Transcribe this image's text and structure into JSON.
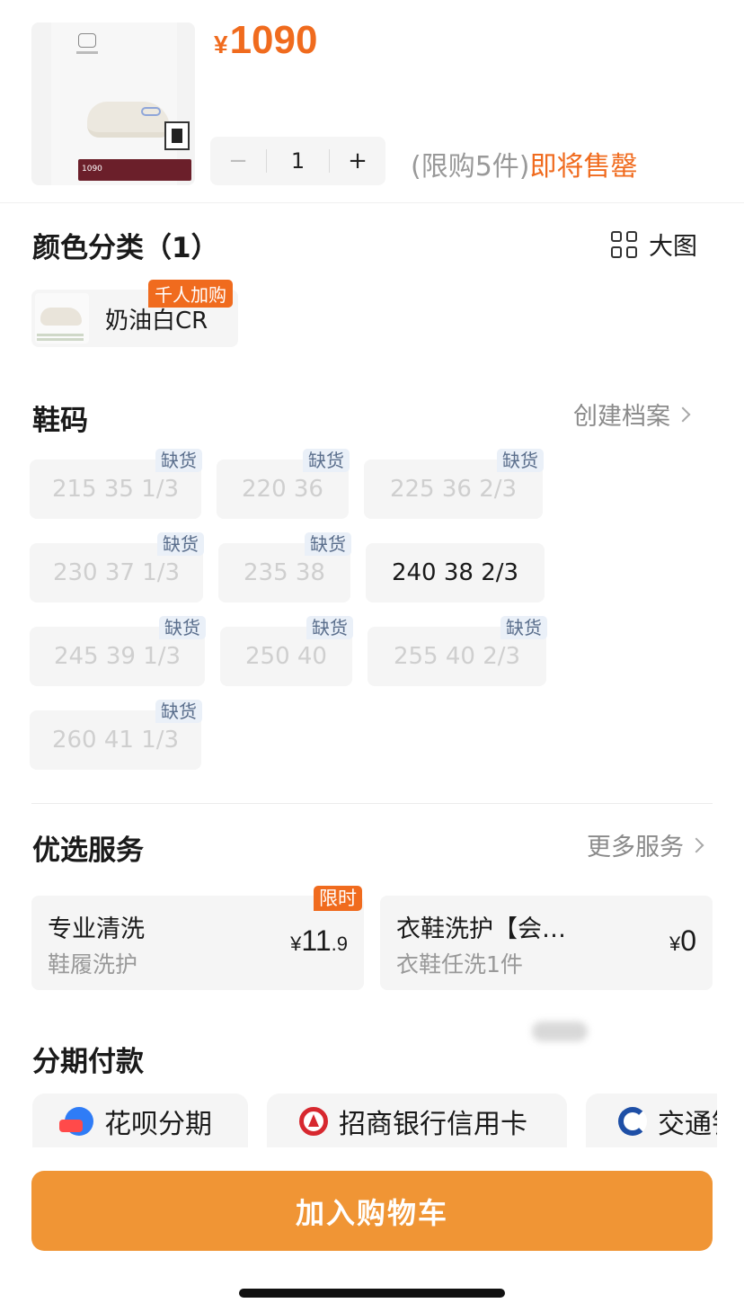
{
  "product": {
    "thumb_banner_text": "1090",
    "price_currency": "¥",
    "price_value": "1090"
  },
  "quantity": {
    "minus": "−",
    "value": "1",
    "plus": "+",
    "limit_text": "(限购5件)",
    "status_text": "即将售罄"
  },
  "color": {
    "title": "颜色分类（1）",
    "big_image_label": "大图",
    "options": [
      {
        "label": "奶油白CR",
        "tag": "千人加购"
      }
    ]
  },
  "size": {
    "title": "鞋码",
    "profile_link": "创建档案",
    "oos_tag": "缺货",
    "options": [
      {
        "label": "215 35 1/3",
        "available": false
      },
      {
        "label": "220 36",
        "available": false
      },
      {
        "label": "225 36 2/3",
        "available": false
      },
      {
        "label": "230 37 1/3",
        "available": false
      },
      {
        "label": "235 38",
        "available": false
      },
      {
        "label": "240 38 2/3",
        "available": true
      },
      {
        "label": "245 39 1/3",
        "available": false
      },
      {
        "label": "250 40",
        "available": false
      },
      {
        "label": "255 40 2/3",
        "available": false
      },
      {
        "label": "260 41 1/3",
        "available": false
      }
    ]
  },
  "services": {
    "title": "优选服务",
    "more_link": "更多服务",
    "items": [
      {
        "name": "专业清洗",
        "sub": "鞋履洗护",
        "currency": "¥",
        "amount_main": "11",
        "amount_dec": ".9",
        "tag": "限时"
      },
      {
        "name": "衣鞋洗护【会…",
        "sub": "衣鞋任洗1件",
        "currency": "¥",
        "amount_main": "0",
        "amount_dec": ""
      }
    ]
  },
  "installment": {
    "title": "分期付款",
    "options": [
      {
        "label": "花呗分期",
        "icon": "huabei-icon"
      },
      {
        "label": "招商银行信用卡",
        "icon": "cmb-bank-icon"
      },
      {
        "label": "交通银",
        "icon": "bocom-bank-icon"
      }
    ]
  },
  "cta": {
    "add_to_cart": "加入购物车"
  },
  "colors": {
    "accent": "#f06b1e",
    "cta": "#f09535",
    "chip_bg": "#f5f5f5"
  }
}
